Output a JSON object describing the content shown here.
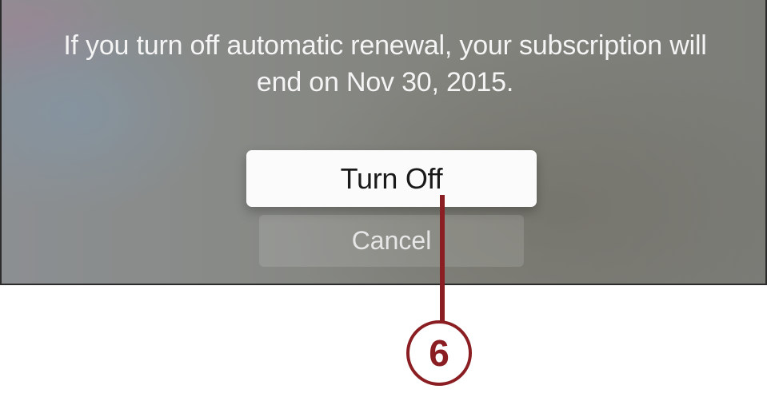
{
  "dialog": {
    "message_line1": "If you turn off automatic renewal, your subscription will",
    "message_line2": "end on Nov 30, 2015.",
    "turn_off_label": "Turn Off",
    "cancel_label": "Cancel"
  },
  "callout": {
    "number": "6",
    "color": "#8a1e22"
  }
}
